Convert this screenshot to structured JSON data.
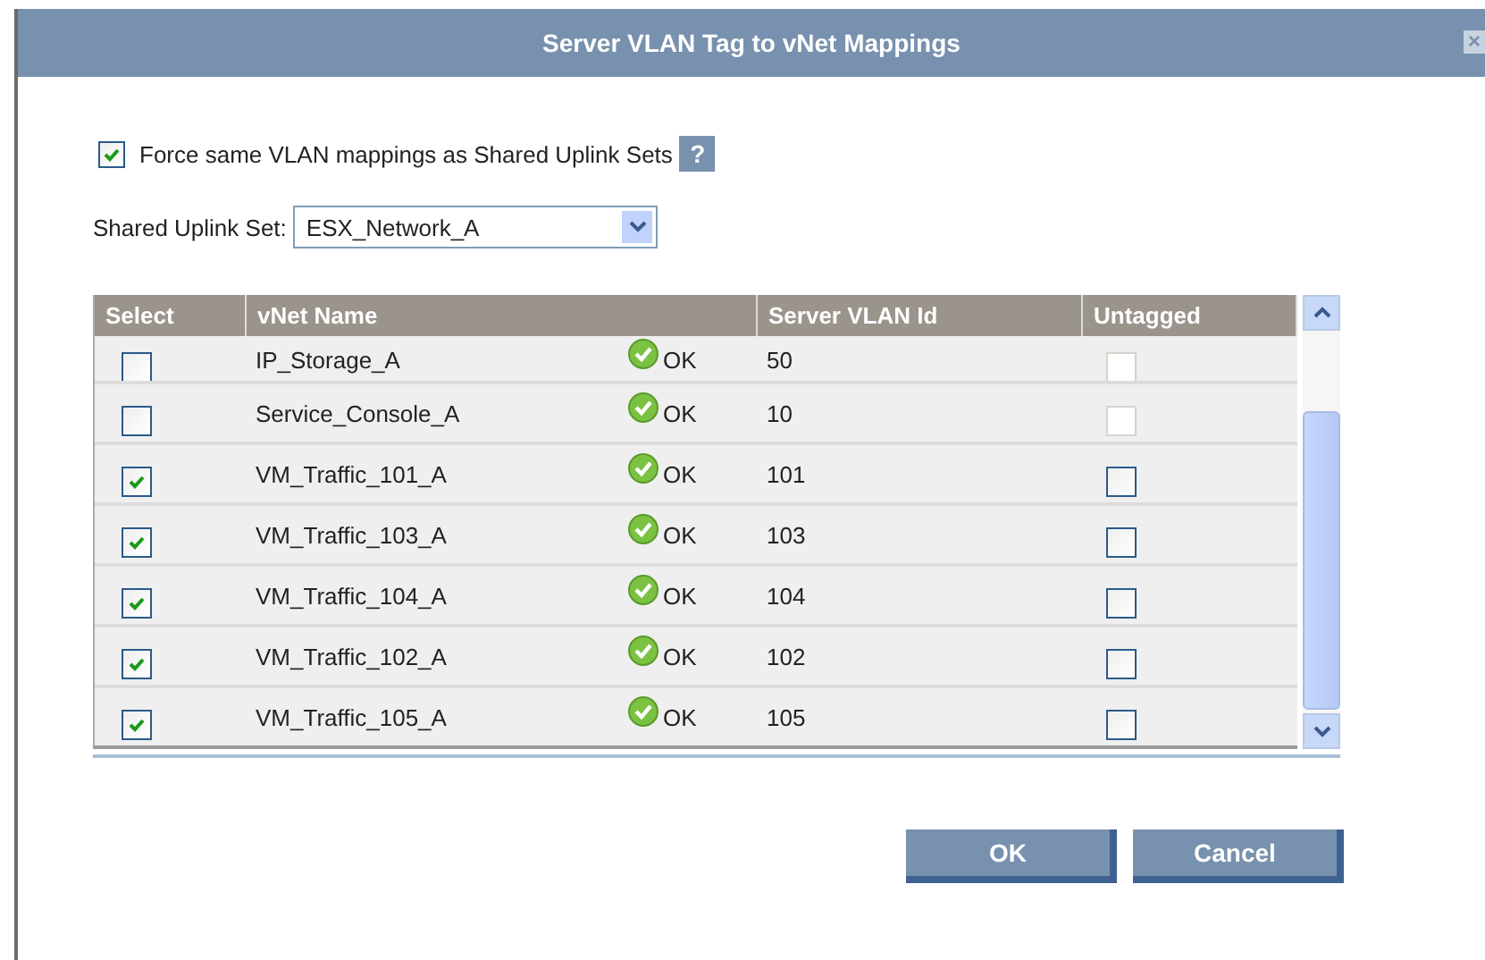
{
  "dialog": {
    "title": "Server VLAN Tag to vNet Mappings",
    "close": "×"
  },
  "force": {
    "label": "Force same VLAN mappings as Shared Uplink Sets",
    "checked": true,
    "help": "?"
  },
  "uplink": {
    "label": "Shared Uplink Set:",
    "value": "ESX_Network_A"
  },
  "table": {
    "columns": [
      "Select",
      "vNet Name",
      "Server VLAN Id",
      "Untagged"
    ],
    "rows": [
      {
        "selected": false,
        "name": "IP_Storage_A",
        "status": "OK",
        "vlan": "50",
        "untagged": false,
        "untagged_disabled": true,
        "partial": true
      },
      {
        "selected": false,
        "name": "Service_Console_A",
        "status": "OK",
        "vlan": "10",
        "untagged": false,
        "untagged_disabled": true,
        "partial": false
      },
      {
        "selected": true,
        "name": "VM_Traffic_101_A",
        "status": "OK",
        "vlan": "101",
        "untagged": false,
        "untagged_disabled": false,
        "partial": false
      },
      {
        "selected": true,
        "name": "VM_Traffic_103_A",
        "status": "OK",
        "vlan": "103",
        "untagged": false,
        "untagged_disabled": false,
        "partial": false
      },
      {
        "selected": true,
        "name": "VM_Traffic_104_A",
        "status": "OK",
        "vlan": "104",
        "untagged": false,
        "untagged_disabled": false,
        "partial": false
      },
      {
        "selected": true,
        "name": "VM_Traffic_102_A",
        "status": "OK",
        "vlan": "102",
        "untagged": false,
        "untagged_disabled": false,
        "partial": false
      },
      {
        "selected": true,
        "name": "VM_Traffic_105_A",
        "status": "OK",
        "vlan": "105",
        "untagged": false,
        "untagged_disabled": false,
        "partial": false
      }
    ]
  },
  "buttons": [
    "OK",
    "Cancel"
  ]
}
